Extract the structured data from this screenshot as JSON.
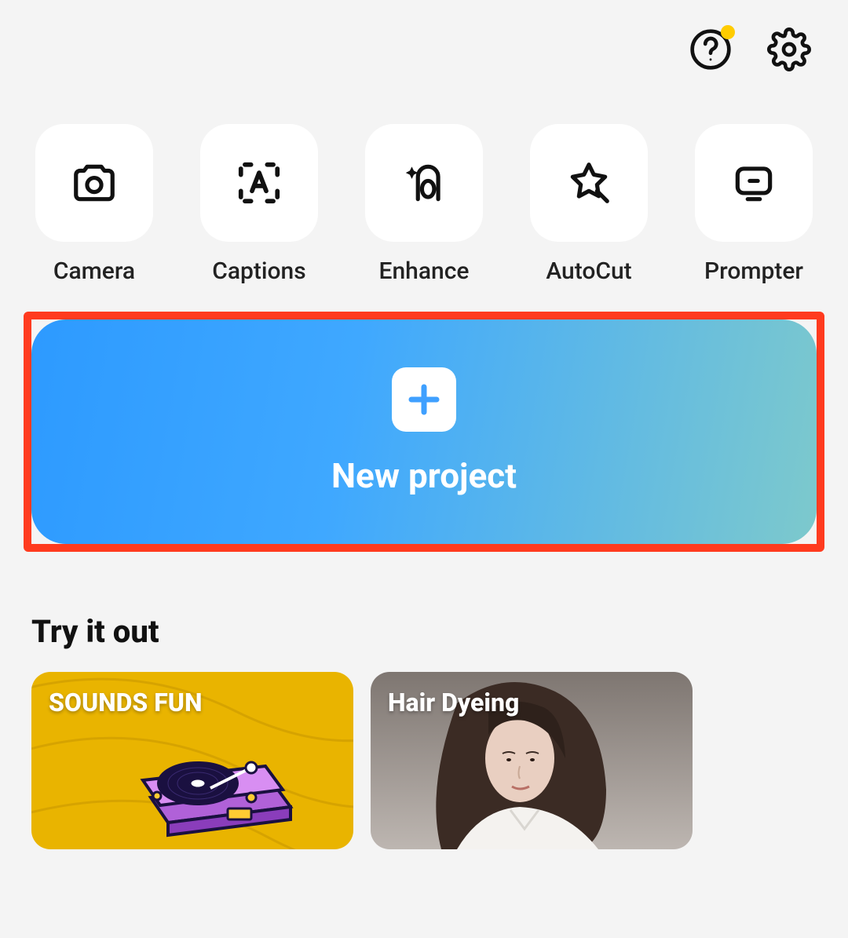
{
  "topbar": {
    "help_notify": true
  },
  "tools": [
    {
      "icon": "camera-icon",
      "label": "Camera"
    },
    {
      "icon": "captions-icon",
      "label": "Captions"
    },
    {
      "icon": "enhance-icon",
      "label": "Enhance"
    },
    {
      "icon": "autocut-icon",
      "label": "AutoCut"
    },
    {
      "icon": "prompter-icon",
      "label": "Prompter"
    }
  ],
  "primary": {
    "new_project_label": "New project"
  },
  "try": {
    "section_title": "Try it out",
    "cards": [
      {
        "label": "SOUNDS FUN"
      },
      {
        "label": "Hair Dyeing"
      }
    ]
  }
}
